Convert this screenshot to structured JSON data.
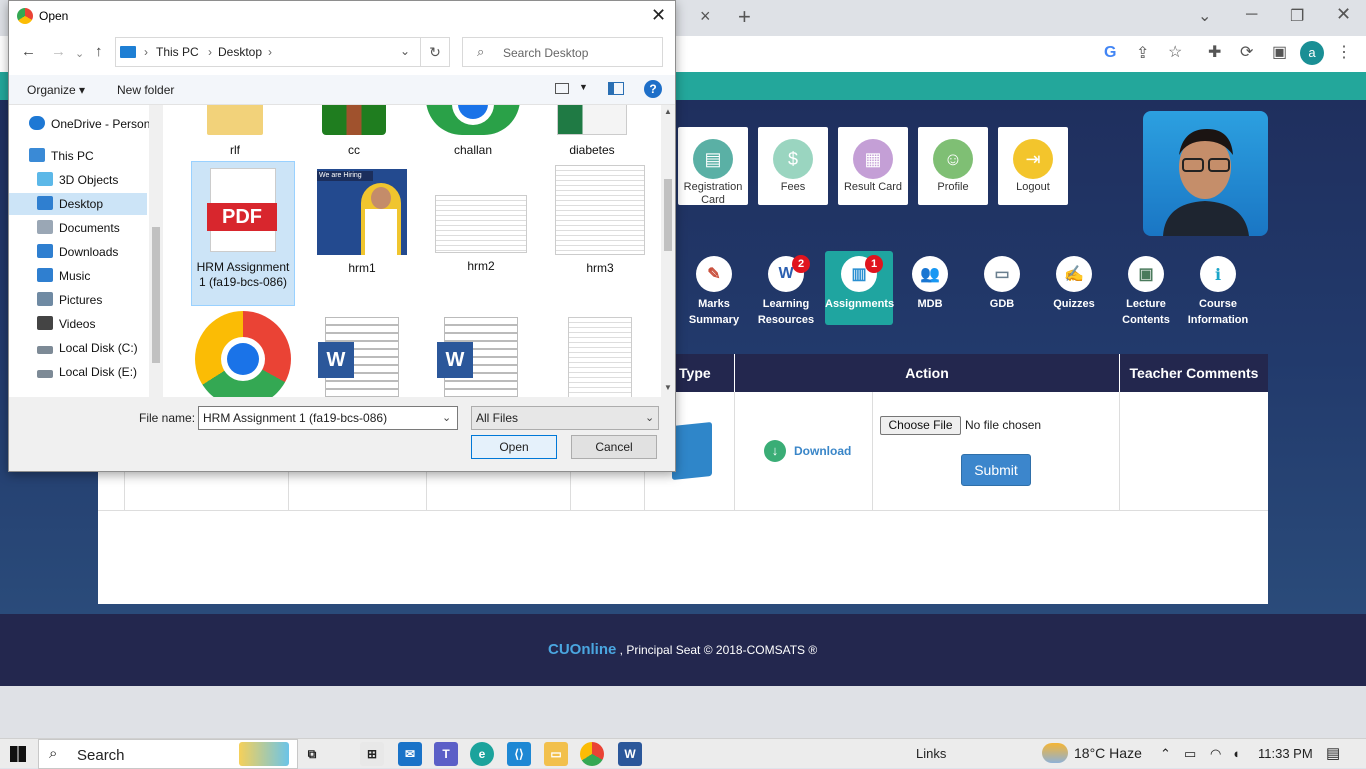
{
  "browser": {
    "tab_close": "×",
    "new_tab": "+",
    "profile_initial": "a",
    "toolbar_icons": [
      "google-icon",
      "share-icon",
      "star-icon",
      "extensions-icon",
      "performance-icon",
      "sidepanel-icon",
      "menu-icon"
    ]
  },
  "cards": [
    {
      "label": "Registration Card",
      "icon": "registration-icon",
      "color": "#5ab0a5"
    },
    {
      "label": "Fees",
      "icon": "fees-icon",
      "color": "#9ad5c0"
    },
    {
      "label": "Result Card",
      "icon": "result-card-icon",
      "color": "#c49fd6"
    },
    {
      "label": "Profile",
      "icon": "profile-icon",
      "color": "#7fbf74"
    },
    {
      "label": "Logout",
      "icon": "logout-icon",
      "color": "#f3c52c"
    }
  ],
  "nav": [
    {
      "label1": "Marks",
      "label2": "Summary",
      "icon": "marks-icon",
      "badge": ""
    },
    {
      "label1": "Learning",
      "label2": "Resources",
      "icon": "learning-icon",
      "badge": "2"
    },
    {
      "label1": "Assignments",
      "label2": "",
      "icon": "assignments-icon",
      "badge": "1"
    },
    {
      "label1": "MDB",
      "label2": "",
      "icon": "mdb-icon",
      "badge": ""
    },
    {
      "label1": "GDB",
      "label2": "",
      "icon": "gdb-icon",
      "badge": ""
    },
    {
      "label1": "Quizzes",
      "label2": "",
      "icon": "quizzes-icon",
      "badge": ""
    },
    {
      "label1": "Lecture",
      "label2": "Contents",
      "icon": "lecture-icon",
      "badge": ""
    },
    {
      "label1": "Course",
      "label2": "Information",
      "icon": "info-icon",
      "badge": ""
    }
  ],
  "table": {
    "headers": [
      "e Type",
      "Action",
      "Teacher Comments"
    ],
    "choose_file": "Choose File",
    "no_file": "No file chosen",
    "submit": "Submit",
    "download": "Download"
  },
  "footer": {
    "brand": "CUOnline",
    "text": " , Principal Seat © 2018-COMSATS ®"
  },
  "dialog": {
    "title": "Open",
    "breadcrumb": [
      "This PC",
      "Desktop"
    ],
    "search_placeholder": "Search Desktop",
    "organize": "Organize ▾",
    "new_folder": "New folder",
    "help": "?",
    "sidebar": [
      "OneDrive - Person",
      "This PC",
      "3D Objects",
      "Desktop",
      "Documents",
      "Downloads",
      "Music",
      "Pictures",
      "Videos",
      "Local Disk (C:)",
      "Local Disk (E:)"
    ],
    "files_row1": [
      "rlf",
      "cc",
      "challan",
      "diabetes"
    ],
    "files_row2": [
      "HRM Assignment 1 (fa19-bcs-086)",
      "hrm1",
      "hrm2",
      "hrm3"
    ],
    "pdf_label": "PDF",
    "hiring_text": "We are Hiring",
    "file_name_label": "File name:",
    "file_name_value": "HRM Assignment 1 (fa19-bcs-086)",
    "file_type": "All Files",
    "open": "Open",
    "cancel": "Cancel"
  },
  "taskbar": {
    "search": "Search",
    "links": "Links",
    "weather": "18°C  Haze",
    "time": "11:33 PM"
  }
}
